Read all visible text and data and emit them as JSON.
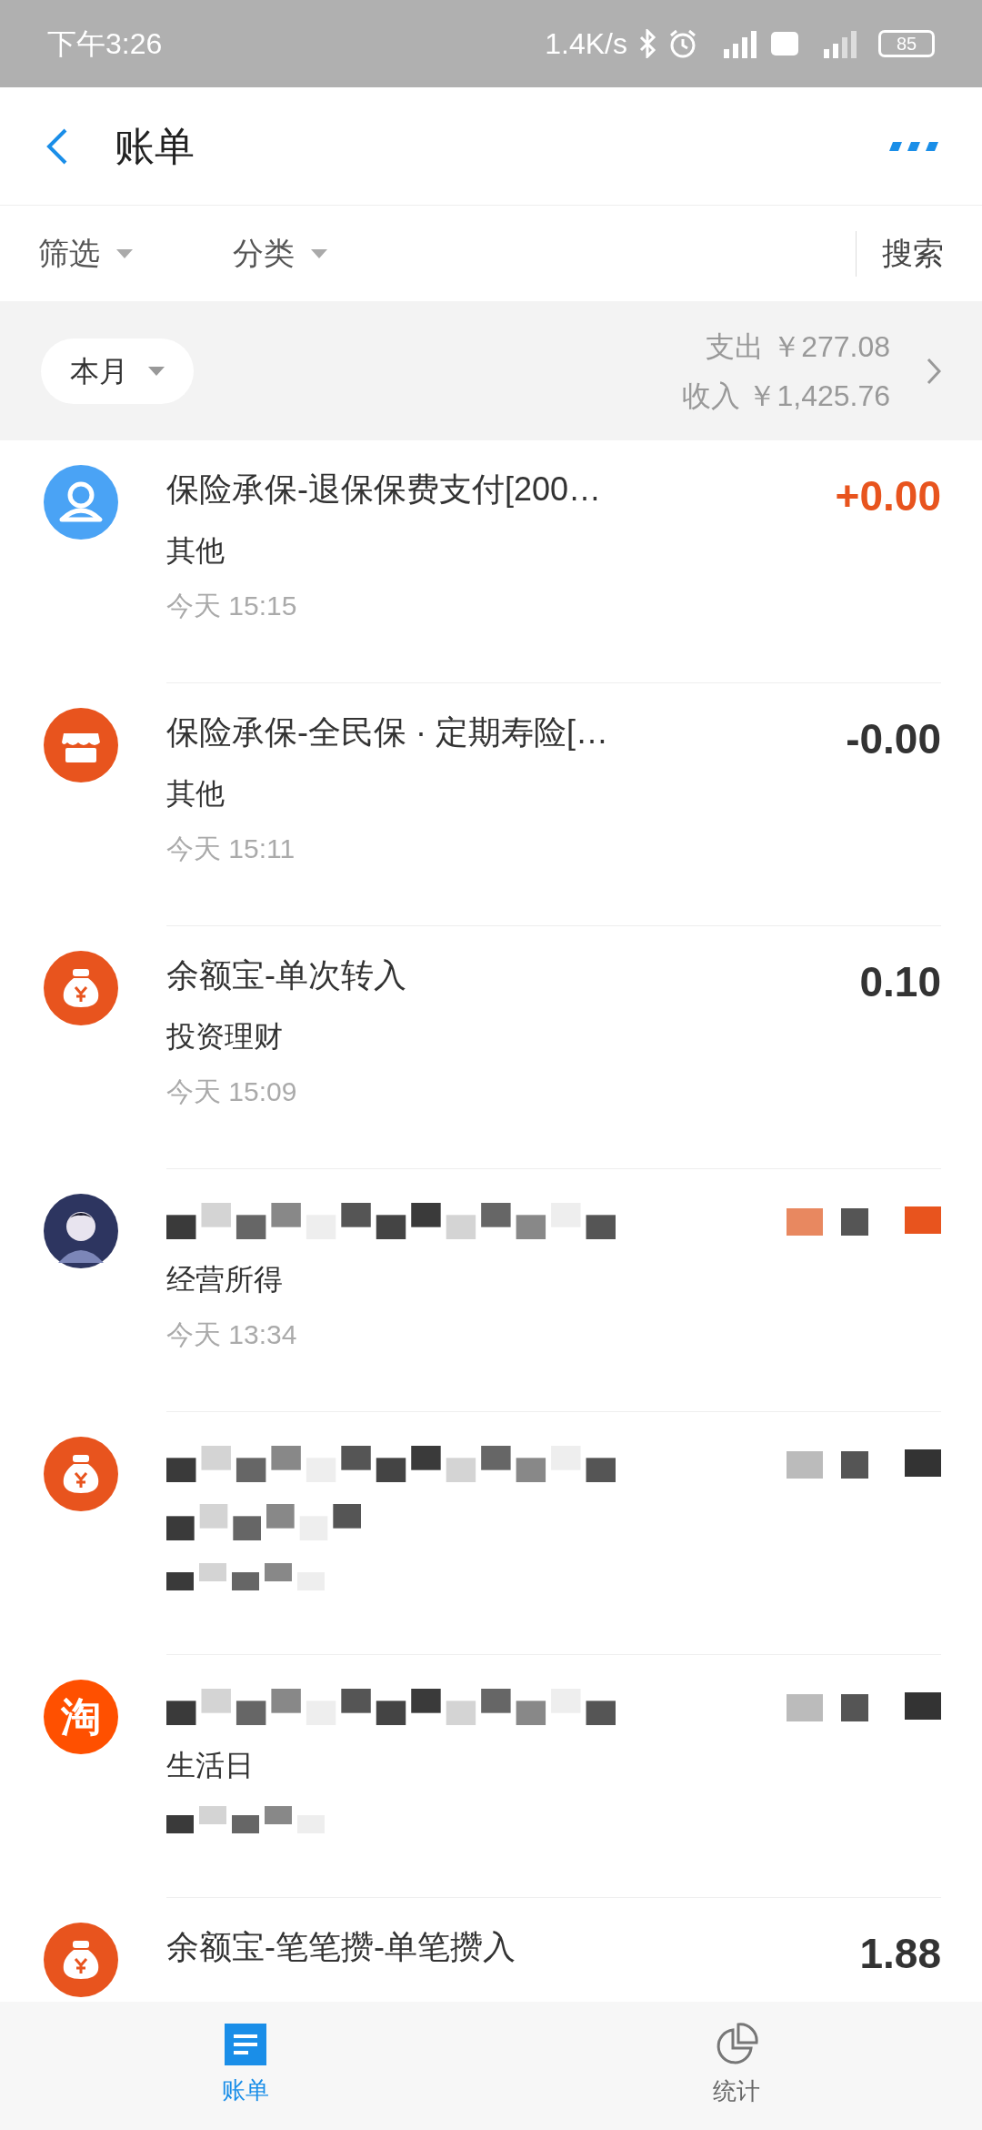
{
  "status_bar": {
    "time": "下午3:26",
    "speed": "1.4K/s",
    "battery": "85"
  },
  "header": {
    "title": "账单"
  },
  "filters": [
    {
      "label": "筛选"
    },
    {
      "label": "分类"
    }
  ],
  "search": "搜索",
  "summary": {
    "period": "本月",
    "expense_label": "支出",
    "expense": "￥277.08",
    "income_label": "收入",
    "income": "￥1,425.76"
  },
  "bills": [
    {
      "kind": "person",
      "title": "保险承保-退保保费支付[200…",
      "category": "其他",
      "day": "今天",
      "time": "15:15",
      "amount": "+0.00",
      "income": true
    },
    {
      "kind": "shop",
      "title": "保险承保-全民保 · 定期寿险[…",
      "category": "其他",
      "day": "今天",
      "time": "15:11",
      "amount": "-0.00",
      "income": false
    },
    {
      "kind": "moneybag",
      "title": "余额宝-单次转入",
      "category": "投资理财",
      "day": "今天",
      "time": "15:09",
      "amount": "0.10",
      "income": false
    },
    {
      "kind": "avatar",
      "category": "经营所得",
      "day": "今天",
      "time": "13:34",
      "income": true,
      "redacted": true
    },
    {
      "kind": "moneybag",
      "income": false,
      "redacted": true
    },
    {
      "kind": "logo",
      "logo": "淘",
      "category": "生活日",
      "income": false,
      "redacted": true
    },
    {
      "kind": "moneybag",
      "title": "余额宝-笔笔攒-单笔攒入",
      "amount": "1.88",
      "income": false,
      "redacted": false
    }
  ],
  "tabs": [
    {
      "label": "账单",
      "selected": true
    },
    {
      "label": "统计",
      "selected": false
    }
  ]
}
